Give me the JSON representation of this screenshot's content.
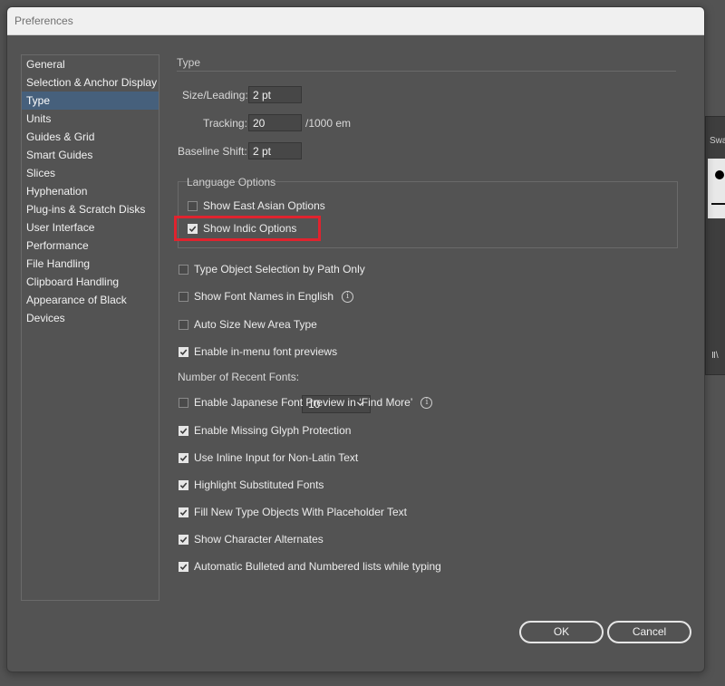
{
  "window": {
    "title": "Preferences"
  },
  "background_panel": {
    "tab_label": "Swa",
    "footer_glyph": "Ⅱ\\"
  },
  "sidebar": {
    "items": [
      {
        "label": "General"
      },
      {
        "label": "Selection & Anchor Display"
      },
      {
        "label": "Type",
        "selected": true
      },
      {
        "label": "Units"
      },
      {
        "label": "Guides & Grid"
      },
      {
        "label": "Smart Guides"
      },
      {
        "label": "Slices"
      },
      {
        "label": "Hyphenation"
      },
      {
        "label": "Plug-ins & Scratch Disks"
      },
      {
        "label": "User Interface"
      },
      {
        "label": "Performance"
      },
      {
        "label": "File Handling"
      },
      {
        "label": "Clipboard Handling"
      },
      {
        "label": "Appearance of Black"
      },
      {
        "label": "Devices"
      }
    ]
  },
  "type_section": {
    "heading": "Type",
    "size_leading": {
      "label": "Size/Leading:",
      "value": "2 pt"
    },
    "tracking": {
      "label": "Tracking:",
      "value": "20",
      "unit": "/1000 em"
    },
    "baseline_shift": {
      "label": "Baseline Shift:",
      "value": "2 pt"
    }
  },
  "language_options": {
    "heading": "Language Options",
    "east_asian": {
      "label": "Show East Asian Options",
      "checked": false
    },
    "indic": {
      "label": "Show Indic Options",
      "checked": true
    }
  },
  "options": {
    "type_object_selection": {
      "label": "Type Object Selection by Path Only",
      "checked": false
    },
    "font_names_english": {
      "label": "Show Font Names in English",
      "checked": false,
      "info": "i"
    },
    "auto_size": {
      "label": "Auto Size New Area Type",
      "checked": false
    },
    "inmenu_preview": {
      "label": "Enable in-menu font previews",
      "checked": true
    },
    "recent_fonts": {
      "label": "Number of Recent Fonts:",
      "value": "10"
    },
    "japanese_preview": {
      "label": "Enable Japanese Font Preview in ‘Find More’",
      "checked": false,
      "info": "i"
    },
    "missing_glyph": {
      "label": "Enable Missing Glyph Protection",
      "checked": true
    },
    "inline_input": {
      "label": "Use Inline Input for Non-Latin Text",
      "checked": true
    },
    "highlight_substituted": {
      "label": "Highlight Substituted Fonts",
      "checked": true
    },
    "placeholder_text": {
      "label": "Fill New Type Objects With Placeholder Text",
      "checked": true
    },
    "char_alternates": {
      "label": "Show Character Alternates",
      "checked": true
    },
    "auto_lists": {
      "label": "Automatic Bulleted and Numbered lists while typing",
      "checked": true
    }
  },
  "buttons": {
    "ok": "OK",
    "cancel": "Cancel"
  },
  "colors": {
    "highlight": "#e0232e",
    "selection": "#46607c",
    "dialog_bg": "#535353"
  }
}
